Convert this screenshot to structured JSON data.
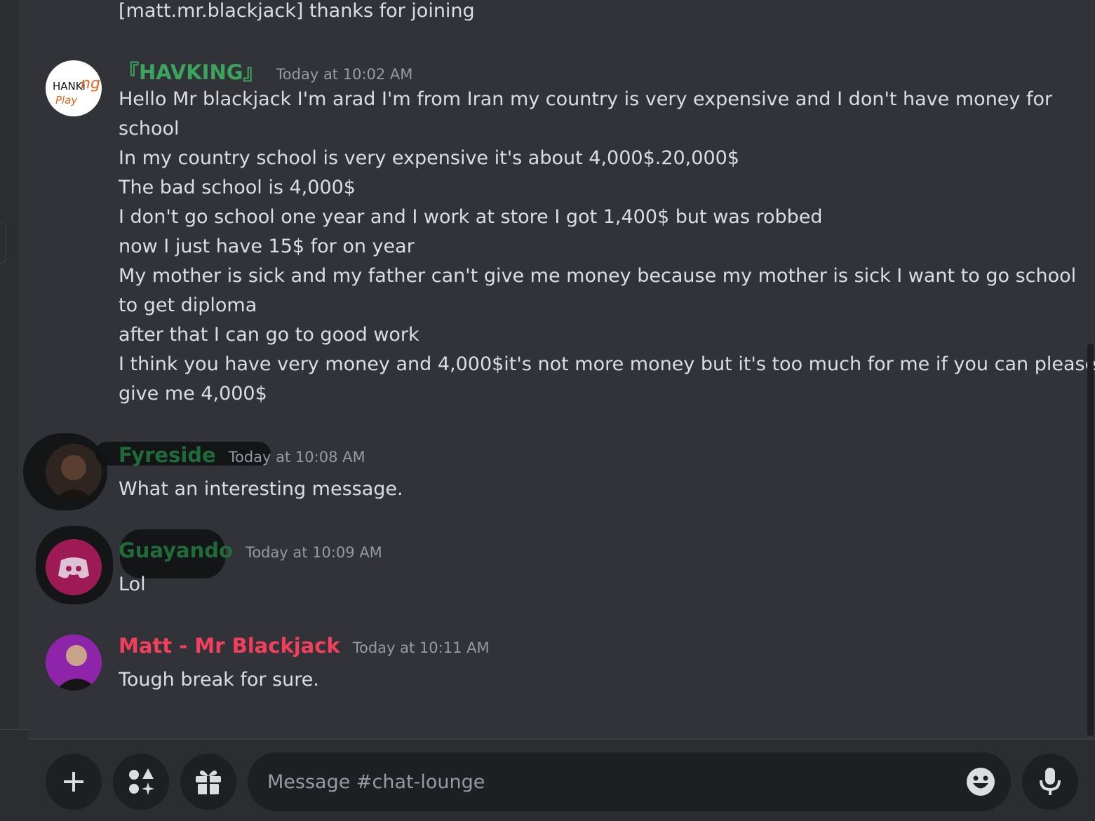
{
  "colors": {
    "havking_name": "#3ba55d",
    "fyreside_name": "#1f6b3a",
    "guayando_name": "#1f6b3a",
    "matt_name": "#f23f5b",
    "timestamp": "#949ba4",
    "text": "#dbdee1"
  },
  "chat": {
    "system_line": "[matt.mr.blackjack] thanks for joining",
    "messages": [
      {
        "author": "『HAVKING』",
        "timestamp": "Today at 10:02 AM",
        "avatar_icon": "havking-playing-logo",
        "avatar_text_1": "HANKi",
        "avatar_text_2": "ng",
        "avatar_text_3": "Play",
        "lines": [
          "Hello Mr blackjack I'm arad I'm from Iran my country is very expensive and I don't have money for",
          "school",
          "In my country school is very expensive it's about 4,000$.20,000$",
          "The bad school is 4,000$",
          "I don't go school one year and I work at store I got 1,400$ but  was robbed",
          "now I just have 15$ for on year",
          "My mother is sick and my father can't give me money because my mother is sick I want to go school",
          "to get diploma",
          "after that I can go to good work",
          "I think you have very money and 4,000$it's not more money but it's too much for me if you can please",
          "give me 4,000$"
        ]
      },
      {
        "author": "Fyreside",
        "timestamp": "Today at 10:08 AM",
        "avatar_icon": "user-photo-avatar",
        "lines": [
          "What an interesting message."
        ]
      },
      {
        "author": "Guayando",
        "timestamp": "Today at 10:09 AM",
        "avatar_icon": "discord-default-avatar",
        "lines": [
          "Lol"
        ]
      },
      {
        "author": "Matt - Mr Blackjack",
        "timestamp": "Today at 10:11 AM",
        "avatar_icon": "user-photo-avatar",
        "lines": [
          "Tough break for sure."
        ]
      }
    ]
  },
  "composer": {
    "placeholder": "Message #chat-lounge",
    "add_icon": "plus-icon",
    "apps_icon": "apps-icon",
    "gift_icon": "gift-icon",
    "emoji_icon": "emoji-icon",
    "mic_icon": "microphone-icon"
  }
}
